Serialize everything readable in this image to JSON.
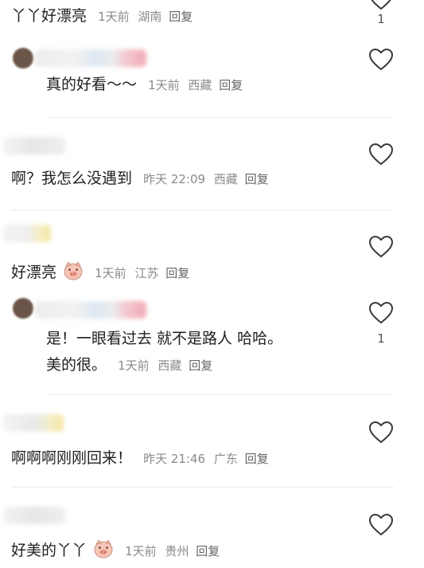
{
  "comments": [
    {
      "text": "丫丫好漂亮",
      "time": "1天前",
      "location": "湖南",
      "reply_label": "回复",
      "likes": "1"
    },
    {
      "text": "真的好看～～",
      "time": "1天前",
      "location": "西藏",
      "reply_label": "回复",
      "likes": ""
    },
    {
      "text": "啊？我怎么没遇到",
      "time": "昨天 22:09",
      "location": "西藏",
      "reply_label": "回复",
      "likes": ""
    },
    {
      "text": "好漂亮",
      "sticker": "pig-sticker-icon",
      "time": "1天前",
      "location": "江苏",
      "reply_label": "回复",
      "likes": ""
    },
    {
      "text_line1": "是！一眼看过去 就不是路人 哈哈。",
      "text_line2": "美的很。",
      "time": "1天前",
      "location": "西藏",
      "reply_label": "回复",
      "likes": "1"
    },
    {
      "text": "啊啊啊刚刚回来！",
      "time": "昨天 21:46",
      "location": "广东",
      "reply_label": "回复",
      "likes": ""
    },
    {
      "text": "好美的丫丫",
      "sticker": "pig-sticker-icon",
      "time": "1天前",
      "location": "贵州",
      "reply_label": "回复",
      "likes": ""
    }
  ],
  "icons": {
    "like": "heart-outline-icon"
  },
  "colors": {
    "meta_text": "#8a8a8a",
    "body_text": "#1f1f1f",
    "divider": "#ececec"
  }
}
